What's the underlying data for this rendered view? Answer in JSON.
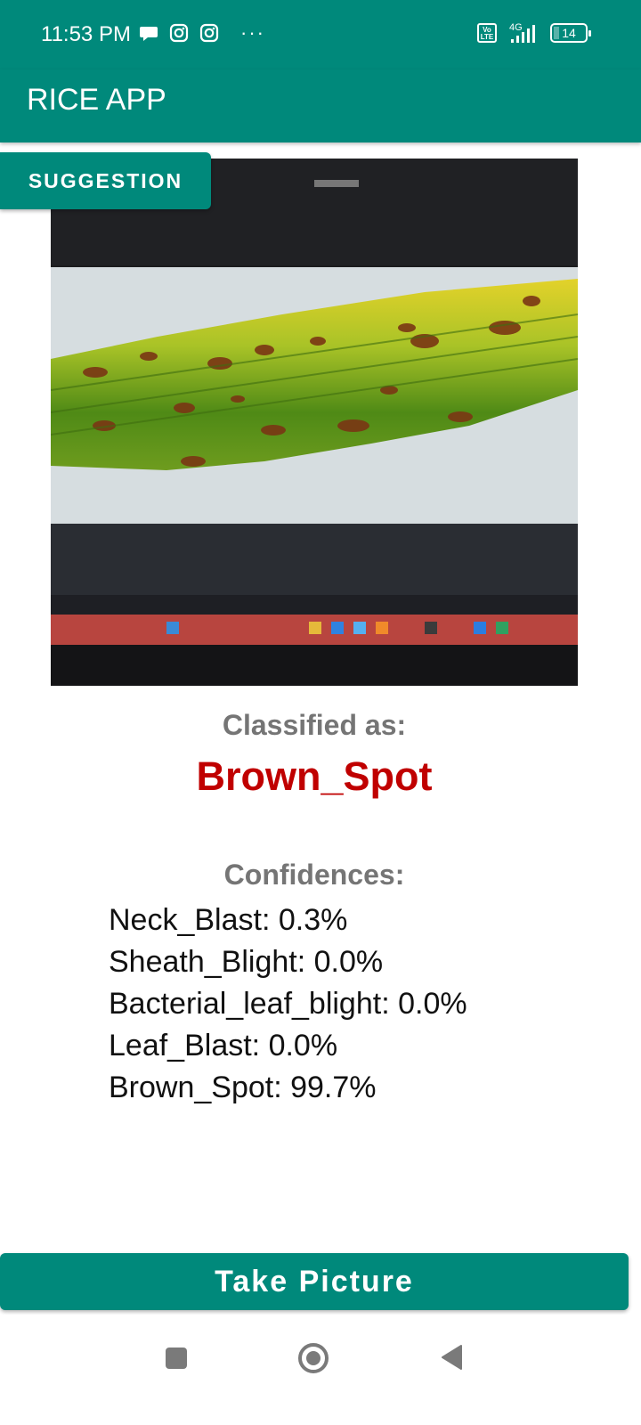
{
  "status_bar": {
    "time": "11:53 PM",
    "left_icons": [
      "chat-bubble-icon",
      "instagram-icon",
      "instagram-icon"
    ],
    "more": "···",
    "volte_label": "Vo LTE",
    "network": "4G",
    "battery": "14"
  },
  "app_bar": {
    "title": "RICE APP"
  },
  "suggestion_button": {
    "label": "SUGGESTION"
  },
  "photo": {
    "subject": "rice-leaf-photo"
  },
  "result": {
    "classified_label": "Classified as:",
    "classified_value": "Brown_Spot",
    "confidences_label": "Confidences:",
    "confidences": [
      "Neck_Blast: 0.3%",
      "Sheath_Blight: 0.0%",
      "Bacterial_leaf_blight: 0.0%",
      "Leaf_Blast: 0.0%",
      "Brown_Spot: 99.7%"
    ]
  },
  "take_picture_button": {
    "label": "Take Picture"
  },
  "colors": {
    "primary": "#00897b",
    "result_red": "#c00000",
    "label_gray": "#757575"
  }
}
